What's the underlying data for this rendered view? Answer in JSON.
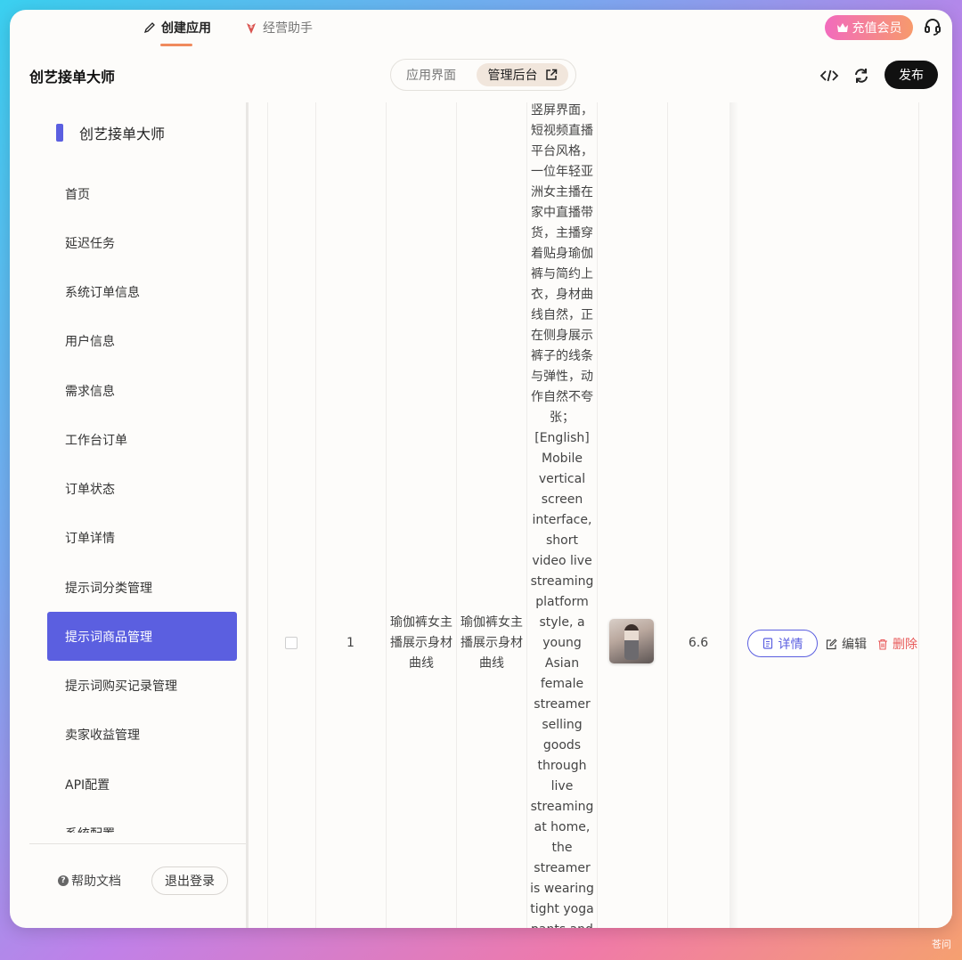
{
  "topnav": {
    "create_tab": "创建应用",
    "ops_tab": "经营助手",
    "vip_button": "充值会员"
  },
  "header": {
    "app_title": "创艺接单大师",
    "seg_app": "应用界面",
    "seg_admin": "管理后台",
    "publish": "发布"
  },
  "sidebar": {
    "brand": "创艺接单大师",
    "items": [
      {
        "label": "首页"
      },
      {
        "label": "延迟任务"
      },
      {
        "label": "系统订单信息"
      },
      {
        "label": "用户信息"
      },
      {
        "label": "需求信息"
      },
      {
        "label": "工作台订单"
      },
      {
        "label": "订单状态"
      },
      {
        "label": "订单详情"
      },
      {
        "label": "提示词分类管理"
      },
      {
        "label": "提示词商品管理",
        "active": true
      },
      {
        "label": "提示词购买记录管理"
      },
      {
        "label": "卖家收益管理"
      },
      {
        "label": "API配置"
      },
      {
        "label": "系统配置"
      }
    ],
    "help": "帮助文档",
    "logout": "退出登录"
  },
  "table": {
    "row": {
      "index": "1",
      "name": "瑜伽裤女主播展示身材曲线",
      "category": "瑜伽裤女主播展示身材曲线",
      "prompt": "竖屏界面，短视频直播平台风格，一位年轻亚洲女主播在家中直播带货，主播穿着贴身瑜伽裤与简约上衣，身材曲线自然，正在侧身展示裤子的线条与弹性，动作自然不夸张；[English] Mobile vertical screen interface, short video live streaming platform style, a young Asian female streamer selling goods through live streaming at home, the streamer is wearing tight yoga pants and a simple top,",
      "price": "6.6",
      "detail": "详情",
      "edit": "编辑",
      "delete": "删除"
    }
  },
  "watermark": "苍问",
  "colors": {
    "accent": "#5b5fe0",
    "danger": "#e85a5a",
    "tab_underline": "#f08a5d"
  }
}
